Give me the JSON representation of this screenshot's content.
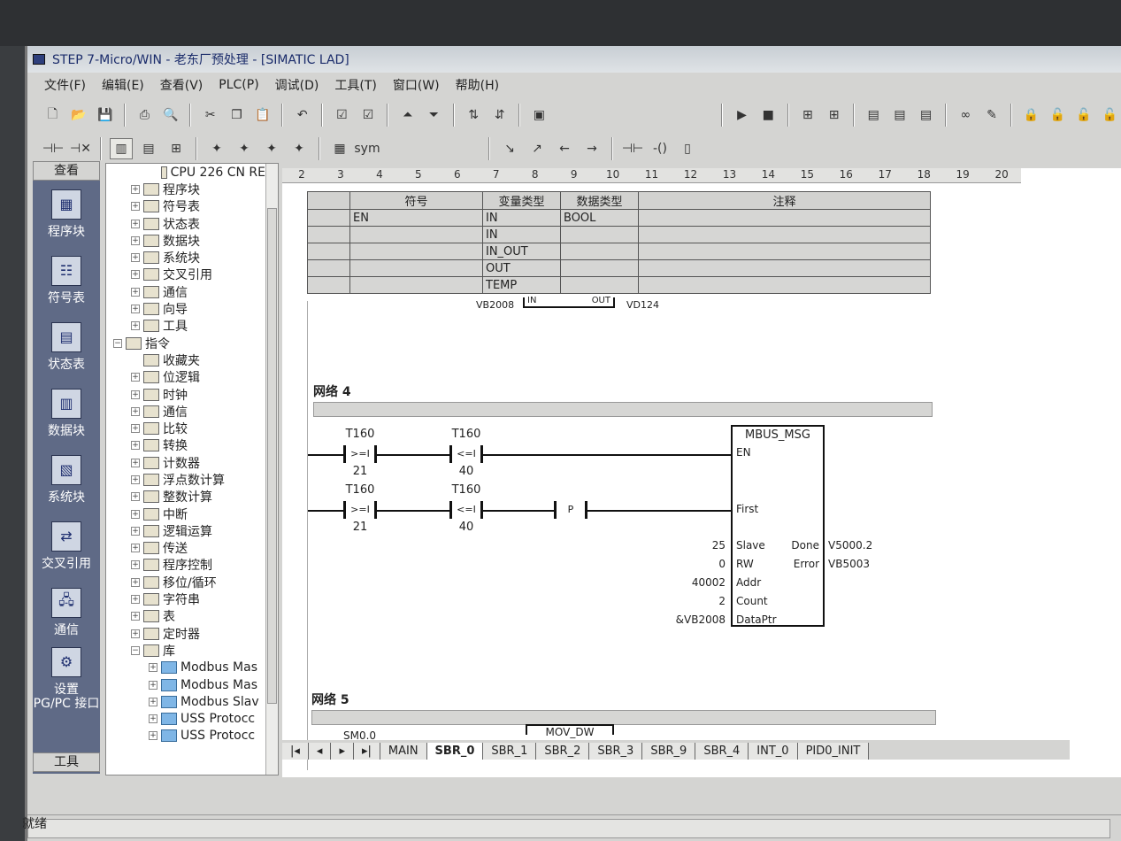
{
  "window": {
    "title": "STEP 7-Micro/WIN - 老东厂预处理 - [SIMATIC LAD]"
  },
  "menu": [
    "文件(F)",
    "编辑(E)",
    "查看(V)",
    "PLC(P)",
    "调试(D)",
    "工具(T)",
    "窗口(W)",
    "帮助(H)"
  ],
  "nav": {
    "header": "查看",
    "items": [
      "程序块",
      "符号表",
      "状态表",
      "数据块",
      "系统块",
      "交叉引用",
      "通信",
      "设置\nPG/PC 接口"
    ],
    "footer": "工具"
  },
  "tree": [
    {
      "label": "CPU 226 CN RE",
      "level": 2,
      "pm": ""
    },
    {
      "label": "程序块",
      "level": 1,
      "pm": "+"
    },
    {
      "label": "符号表",
      "level": 1,
      "pm": "+"
    },
    {
      "label": "状态表",
      "level": 1,
      "pm": "+"
    },
    {
      "label": "数据块",
      "level": 1,
      "pm": "+"
    },
    {
      "label": "系统块",
      "level": 1,
      "pm": "+"
    },
    {
      "label": "交叉引用",
      "level": 1,
      "pm": "+"
    },
    {
      "label": "通信",
      "level": 1,
      "pm": "+"
    },
    {
      "label": "向导",
      "level": 1,
      "pm": "+"
    },
    {
      "label": "工具",
      "level": 1,
      "pm": "+"
    },
    {
      "label": "指令",
      "level": 0,
      "pm": "-"
    },
    {
      "label": "收藏夹",
      "level": 1,
      "pm": ""
    },
    {
      "label": "位逻辑",
      "level": 1,
      "pm": "+"
    },
    {
      "label": "时钟",
      "level": 1,
      "pm": "+"
    },
    {
      "label": "通信",
      "level": 1,
      "pm": "+"
    },
    {
      "label": "比较",
      "level": 1,
      "pm": "+"
    },
    {
      "label": "转换",
      "level": 1,
      "pm": "+"
    },
    {
      "label": "计数器",
      "level": 1,
      "pm": "+"
    },
    {
      "label": "浮点数计算",
      "level": 1,
      "pm": "+"
    },
    {
      "label": "整数计算",
      "level": 1,
      "pm": "+"
    },
    {
      "label": "中断",
      "level": 1,
      "pm": "+"
    },
    {
      "label": "逻辑运算",
      "level": 1,
      "pm": "+"
    },
    {
      "label": "传送",
      "level": 1,
      "pm": "+"
    },
    {
      "label": "程序控制",
      "level": 1,
      "pm": "+"
    },
    {
      "label": "移位/循环",
      "level": 1,
      "pm": "+"
    },
    {
      "label": "字符串",
      "level": 1,
      "pm": "+"
    },
    {
      "label": "表",
      "level": 1,
      "pm": "+"
    },
    {
      "label": "定时器",
      "level": 1,
      "pm": "+"
    },
    {
      "label": "库",
      "level": 1,
      "pm": "-"
    },
    {
      "label": "Modbus Mas",
      "level": 2,
      "pm": "+",
      "folder": true
    },
    {
      "label": "Modbus Mas",
      "level": 2,
      "pm": "+",
      "folder": true
    },
    {
      "label": "Modbus Slav",
      "level": 2,
      "pm": "+",
      "folder": true
    },
    {
      "label": "USS Protocc",
      "level": 2,
      "pm": "+",
      "folder": true
    },
    {
      "label": "USS Protocc",
      "level": 2,
      "pm": "+",
      "folder": true
    }
  ],
  "ruler": [
    "2",
    "3",
    "4",
    "5",
    "6",
    "7",
    "8",
    "9",
    "10",
    "11",
    "12",
    "13",
    "14",
    "15",
    "16",
    "17",
    "18",
    "19",
    "20"
  ],
  "vartable": {
    "headers": [
      "符号",
      "变量类型",
      "数据类型",
      "注释"
    ],
    "rows": [
      [
        "EN",
        "IN",
        "BOOL",
        ""
      ],
      [
        "",
        "IN",
        "",
        ""
      ],
      [
        "",
        "IN_OUT",
        "",
        ""
      ],
      [
        "",
        "OUT",
        "",
        ""
      ],
      [
        "",
        "TEMP",
        "",
        ""
      ]
    ]
  },
  "ladder": {
    "prev_tail": {
      "left": "VB2008",
      "in": "IN",
      "out": "OUT",
      "right": "VD124"
    },
    "network4": {
      "label": "网络 4",
      "rung1": [
        {
          "op": "T160",
          "cmp": ">=I",
          "val": "21"
        },
        {
          "op": "T160",
          "cmp": "<=I",
          "val": "40"
        }
      ],
      "rung2": [
        {
          "op": "T160",
          "cmp": ">=I",
          "val": "21"
        },
        {
          "op": "T160",
          "cmp": "<=I",
          "val": "40"
        }
      ],
      "p": "P",
      "block": {
        "title": "MBUS_MSG",
        "en": "EN",
        "first": "First",
        "inputs": [
          {
            "val": "25",
            "pin": "Slave"
          },
          {
            "val": "0",
            "pin": "RW"
          },
          {
            "val": "40002",
            "pin": "Addr"
          },
          {
            "val": "2",
            "pin": "Count"
          },
          {
            "val": "&VB2008",
            "pin": "DataPtr"
          }
        ],
        "outputs": [
          {
            "pin": "Done",
            "val": "V5000.2"
          },
          {
            "pin": "Error",
            "val": "VB5003"
          }
        ]
      }
    },
    "network5": {
      "label": "网络 5",
      "sm": "SM0.0",
      "mov": "MOV_DW"
    }
  },
  "tabs": [
    "MAIN",
    "SBR_0",
    "SBR_1",
    "SBR_2",
    "SBR_3",
    "SBR_9",
    "SBR_4",
    "INT_0",
    "PID0_INIT"
  ],
  "active_tab": "SBR_0",
  "status": {
    "text": "就绪"
  }
}
